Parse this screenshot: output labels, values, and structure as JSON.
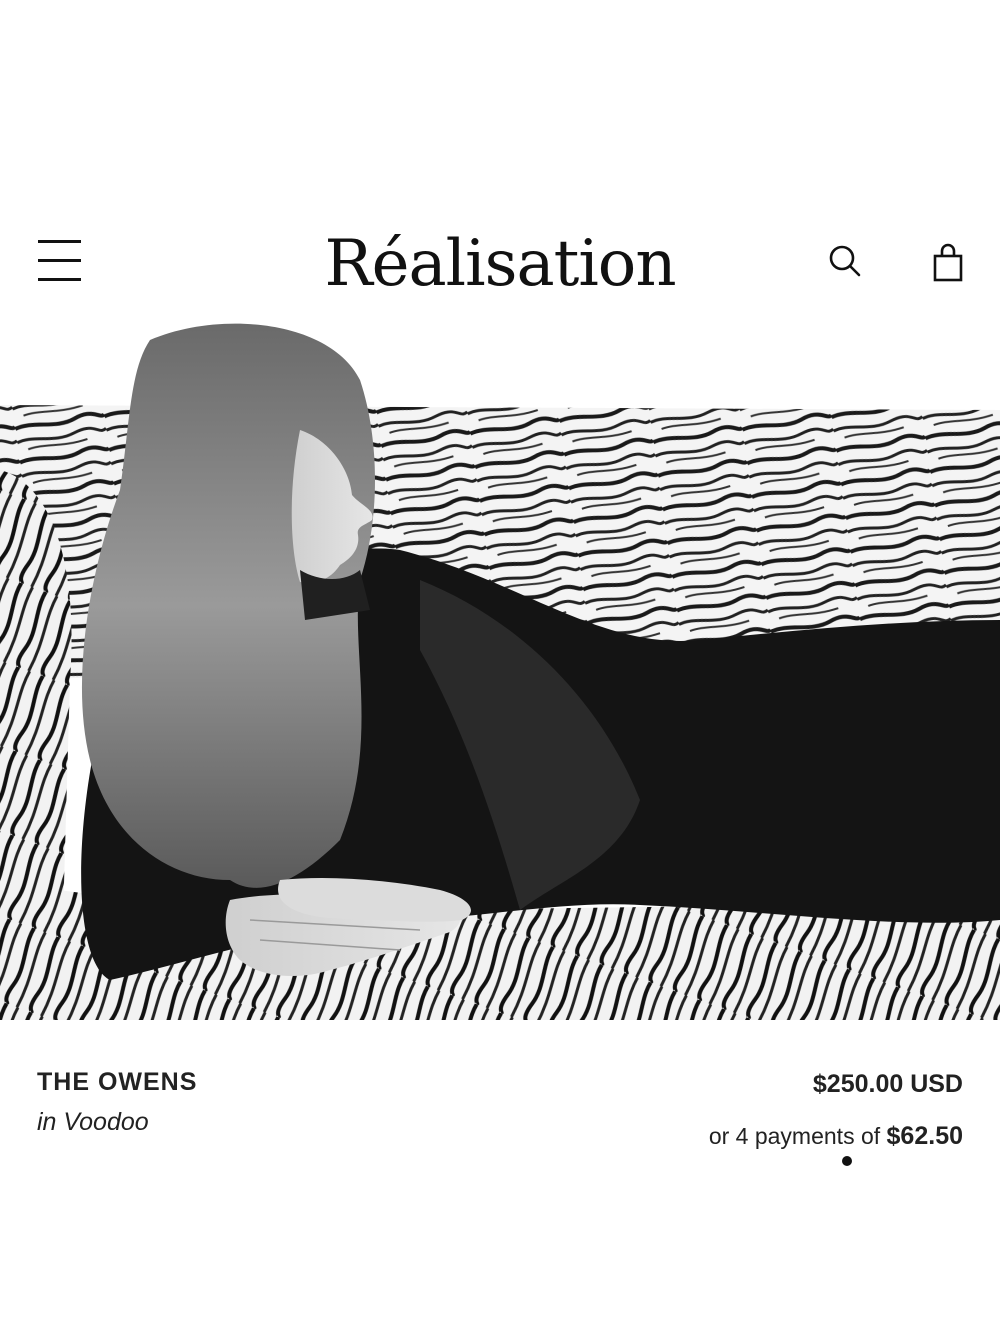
{
  "header": {
    "brand": "Réalisation",
    "icons": [
      "hamburger-menu-icon",
      "search-icon",
      "shopping-bag-icon"
    ]
  },
  "product": {
    "name": "THE OWENS",
    "variant": "in Voodoo",
    "price": "$250.00 USD",
    "installments_prefix": "or 4 payments of",
    "installment_amount": "$62.50"
  },
  "colors": {
    "text": "#111111",
    "background": "#ffffff"
  }
}
